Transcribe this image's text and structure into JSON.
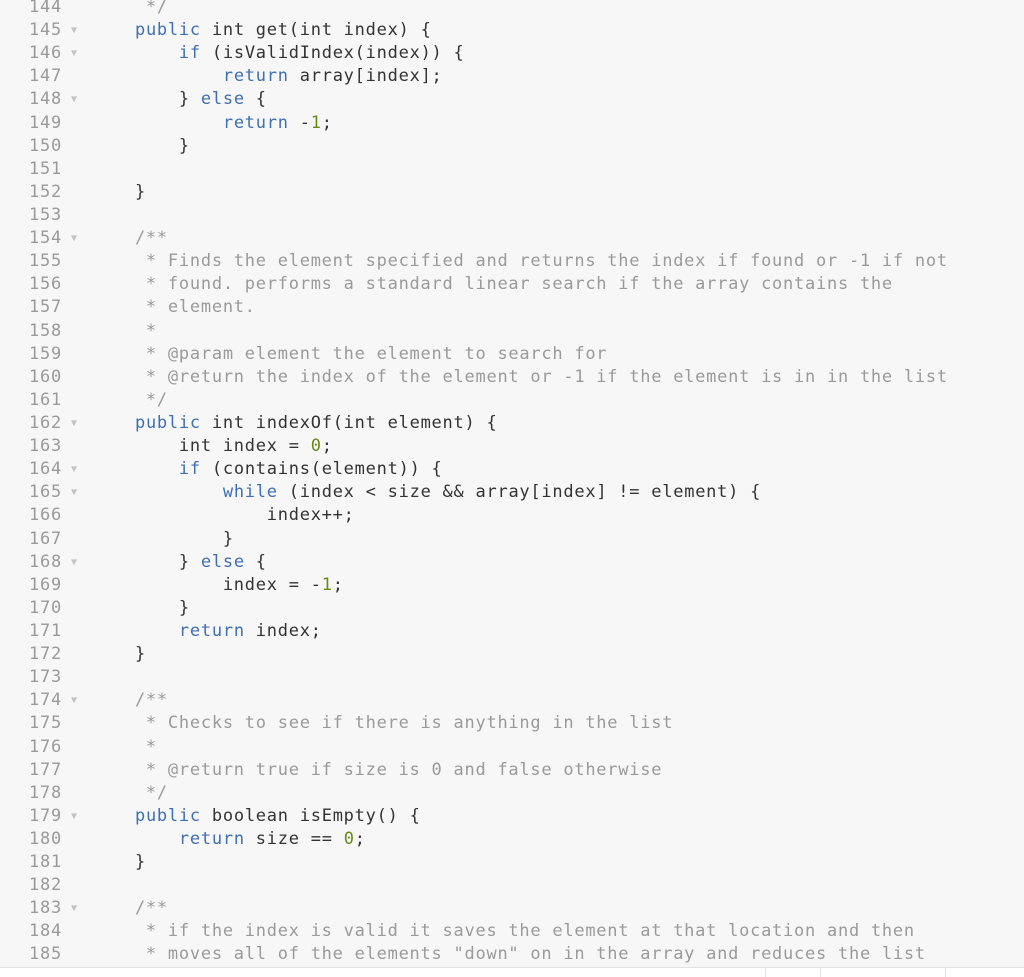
{
  "editor": {
    "language": "java",
    "colors": {
      "background": "#f7f7f7",
      "keyword": "#3f6fb4",
      "number": "#6a8a16",
      "comment": "#9a9a9a",
      "text": "#333333",
      "line_number": "#9a9a9a"
    },
    "lines": [
      {
        "n": "144",
        "fold": false,
        "tokens": [
          {
            "t": "cm",
            "v": "     */"
          }
        ]
      },
      {
        "n": "145",
        "fold": true,
        "tokens": [
          {
            "t": "plain",
            "v": "    "
          },
          {
            "t": "kw",
            "v": "public"
          },
          {
            "t": "plain",
            "v": " int get(int index) {"
          }
        ]
      },
      {
        "n": "146",
        "fold": true,
        "tokens": [
          {
            "t": "plain",
            "v": "        "
          },
          {
            "t": "kw",
            "v": "if"
          },
          {
            "t": "plain",
            "v": " (isValidIndex(index)) {"
          }
        ]
      },
      {
        "n": "147",
        "fold": false,
        "tokens": [
          {
            "t": "plain",
            "v": "            "
          },
          {
            "t": "kw",
            "v": "return"
          },
          {
            "t": "plain",
            "v": " array[index];"
          }
        ]
      },
      {
        "n": "148",
        "fold": true,
        "tokens": [
          {
            "t": "plain",
            "v": "        } "
          },
          {
            "t": "kw",
            "v": "else"
          },
          {
            "t": "plain",
            "v": " {"
          }
        ]
      },
      {
        "n": "149",
        "fold": false,
        "tokens": [
          {
            "t": "plain",
            "v": "            "
          },
          {
            "t": "kw",
            "v": "return"
          },
          {
            "t": "plain",
            "v": " -"
          },
          {
            "t": "num",
            "v": "1"
          },
          {
            "t": "plain",
            "v": ";"
          }
        ]
      },
      {
        "n": "150",
        "fold": false,
        "tokens": [
          {
            "t": "plain",
            "v": "        }"
          }
        ]
      },
      {
        "n": "151",
        "fold": false,
        "tokens": []
      },
      {
        "n": "152",
        "fold": false,
        "tokens": [
          {
            "t": "plain",
            "v": "    }"
          }
        ]
      },
      {
        "n": "153",
        "fold": false,
        "tokens": []
      },
      {
        "n": "154",
        "fold": true,
        "tokens": [
          {
            "t": "cm",
            "v": "    /**"
          }
        ]
      },
      {
        "n": "155",
        "fold": false,
        "tokens": [
          {
            "t": "cm",
            "v": "     * Finds the element specified and returns the index if found or -1 if not"
          }
        ]
      },
      {
        "n": "156",
        "fold": false,
        "tokens": [
          {
            "t": "cm",
            "v": "     * found. performs a standard linear search if the array contains the"
          }
        ]
      },
      {
        "n": "157",
        "fold": false,
        "tokens": [
          {
            "t": "cm",
            "v": "     * element."
          }
        ]
      },
      {
        "n": "158",
        "fold": false,
        "tokens": [
          {
            "t": "cm",
            "v": "     *"
          }
        ]
      },
      {
        "n": "159",
        "fold": false,
        "tokens": [
          {
            "t": "cm",
            "v": "     * @param element the element to search for"
          }
        ]
      },
      {
        "n": "160",
        "fold": false,
        "tokens": [
          {
            "t": "cm",
            "v": "     * @return the index of the element or -1 if the element is in in the list"
          }
        ]
      },
      {
        "n": "161",
        "fold": false,
        "tokens": [
          {
            "t": "cm",
            "v": "     */"
          }
        ]
      },
      {
        "n": "162",
        "fold": true,
        "tokens": [
          {
            "t": "plain",
            "v": "    "
          },
          {
            "t": "kw",
            "v": "public"
          },
          {
            "t": "plain",
            "v": " int indexOf(int element) {"
          }
        ]
      },
      {
        "n": "163",
        "fold": false,
        "tokens": [
          {
            "t": "plain",
            "v": "        int index = "
          },
          {
            "t": "num",
            "v": "0"
          },
          {
            "t": "plain",
            "v": ";"
          }
        ]
      },
      {
        "n": "164",
        "fold": true,
        "tokens": [
          {
            "t": "plain",
            "v": "        "
          },
          {
            "t": "kw",
            "v": "if"
          },
          {
            "t": "plain",
            "v": " (contains(element)) {"
          }
        ]
      },
      {
        "n": "165",
        "fold": true,
        "tokens": [
          {
            "t": "plain",
            "v": "            "
          },
          {
            "t": "kw",
            "v": "while"
          },
          {
            "t": "plain",
            "v": " (index < size && array[index] != element) {"
          }
        ]
      },
      {
        "n": "166",
        "fold": false,
        "tokens": [
          {
            "t": "plain",
            "v": "                index++;"
          }
        ]
      },
      {
        "n": "167",
        "fold": false,
        "tokens": [
          {
            "t": "plain",
            "v": "            }"
          }
        ]
      },
      {
        "n": "168",
        "fold": true,
        "tokens": [
          {
            "t": "plain",
            "v": "        } "
          },
          {
            "t": "kw",
            "v": "else"
          },
          {
            "t": "plain",
            "v": " {"
          }
        ]
      },
      {
        "n": "169",
        "fold": false,
        "tokens": [
          {
            "t": "plain",
            "v": "            index = -"
          },
          {
            "t": "num",
            "v": "1"
          },
          {
            "t": "plain",
            "v": ";"
          }
        ]
      },
      {
        "n": "170",
        "fold": false,
        "tokens": [
          {
            "t": "plain",
            "v": "        }"
          }
        ]
      },
      {
        "n": "171",
        "fold": false,
        "tokens": [
          {
            "t": "plain",
            "v": "        "
          },
          {
            "t": "kw",
            "v": "return"
          },
          {
            "t": "plain",
            "v": " index;"
          }
        ]
      },
      {
        "n": "172",
        "fold": false,
        "tokens": [
          {
            "t": "plain",
            "v": "    }"
          }
        ]
      },
      {
        "n": "173",
        "fold": false,
        "tokens": []
      },
      {
        "n": "174",
        "fold": true,
        "tokens": [
          {
            "t": "cm",
            "v": "    /**"
          }
        ]
      },
      {
        "n": "175",
        "fold": false,
        "tokens": [
          {
            "t": "cm",
            "v": "     * Checks to see if there is anything in the list"
          }
        ]
      },
      {
        "n": "176",
        "fold": false,
        "tokens": [
          {
            "t": "cm",
            "v": "     *"
          }
        ]
      },
      {
        "n": "177",
        "fold": false,
        "tokens": [
          {
            "t": "cm",
            "v": "     * @return true if size is 0 and false otherwise"
          }
        ]
      },
      {
        "n": "178",
        "fold": false,
        "tokens": [
          {
            "t": "cm",
            "v": "     */"
          }
        ]
      },
      {
        "n": "179",
        "fold": true,
        "tokens": [
          {
            "t": "plain",
            "v": "    "
          },
          {
            "t": "kw",
            "v": "public"
          },
          {
            "t": "plain",
            "v": " boolean isEmpty() {"
          }
        ]
      },
      {
        "n": "180",
        "fold": false,
        "tokens": [
          {
            "t": "plain",
            "v": "        "
          },
          {
            "t": "kw",
            "v": "return"
          },
          {
            "t": "plain",
            "v": " size == "
          },
          {
            "t": "num",
            "v": "0"
          },
          {
            "t": "plain",
            "v": ";"
          }
        ]
      },
      {
        "n": "181",
        "fold": false,
        "tokens": [
          {
            "t": "plain",
            "v": "    }"
          }
        ]
      },
      {
        "n": "182",
        "fold": false,
        "tokens": []
      },
      {
        "n": "183",
        "fold": true,
        "tokens": [
          {
            "t": "cm",
            "v": "    /**"
          }
        ]
      },
      {
        "n": "184",
        "fold": false,
        "tokens": [
          {
            "t": "cm",
            "v": "     * if the index is valid it saves the element at that location and then"
          }
        ]
      },
      {
        "n": "185",
        "fold": false,
        "tokens": [
          {
            "t": "cm",
            "v": "     * moves all of the elements \"down\" on in the array and reduces the list"
          }
        ]
      }
    ],
    "fold_icon": "triangle-down-icon"
  }
}
